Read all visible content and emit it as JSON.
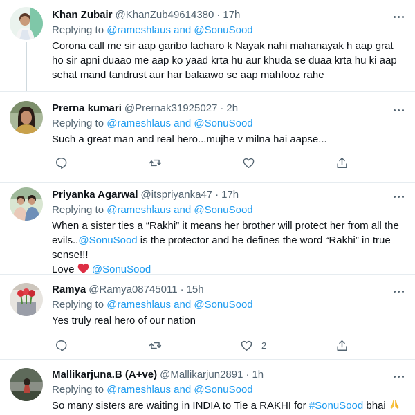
{
  "tweets": [
    {
      "display_name": "Khan Zubair",
      "handle": "@KhanZub49614380",
      "separator": "·",
      "time": "17h",
      "reply_prefix": "Replying to",
      "reply_targets": "@rameshlaus and @SonuSood",
      "text": "Corona call me sir aap garibo lacharo k Nayak nahi mahanayak h aap grat ho sir apni duaao me aap ko yaad krta hu aur khuda se duaa krta hu ki aap sehat mand tandrust aur har balaawo se aap mahfooz rahe"
    },
    {
      "display_name": "Prerna kumari",
      "handle": "@Prernak31925027",
      "separator": "·",
      "time": "2h",
      "reply_prefix": "Replying to",
      "reply_targets": "@rameshlaus and @SonuSood",
      "text": "Such a great man and real hero...mujhe v milna hai aapse..."
    },
    {
      "display_name": "Priyanka Agarwal",
      "handle": "@itspriyanka47",
      "separator": "·",
      "time": "17h",
      "reply_prefix": "Replying to",
      "reply_targets": "@rameshlaus and @SonuSood",
      "text_part1": "When a sister ties a “Rakhi” it means her brother will protect her from all the evils..",
      "text_mention": "@SonuSood",
      "text_part2": " is the protector and he defines the word “Rakhi” in true sense!!!",
      "text_love": "Love",
      "text_love_mention": "@SonuSood"
    },
    {
      "display_name": "Ramya",
      "handle": "@Ramya08745011",
      "separator": "·",
      "time": "15h",
      "reply_prefix": "Replying to",
      "reply_targets": "@rameshlaus and @SonuSood",
      "text": "Yes truly real hero of our nation",
      "like_count": "2"
    },
    {
      "display_name": "Mallikarjuna.B (A+ve)",
      "handle": "@Mallikarjun2891",
      "separator": "·",
      "time": "1h",
      "reply_prefix": "Replying to",
      "reply_targets": "@rameshlaus and @SonuSood",
      "text_part1": "So many sisters are waiting in INDIA to Tie a RAKHI for ",
      "text_hashtag": "#SonuSood",
      "text_part2": " bhai"
    }
  ],
  "colors": {
    "link": "#1d9bf0",
    "secondary_text": "#536471",
    "primary_text": "#0f1419",
    "divider": "#e6ecf0"
  },
  "icons": [
    "more-icon",
    "reply-icon",
    "retweet-icon",
    "like-icon",
    "share-icon",
    "red-heart-emoji",
    "folded-hands-emoji"
  ]
}
